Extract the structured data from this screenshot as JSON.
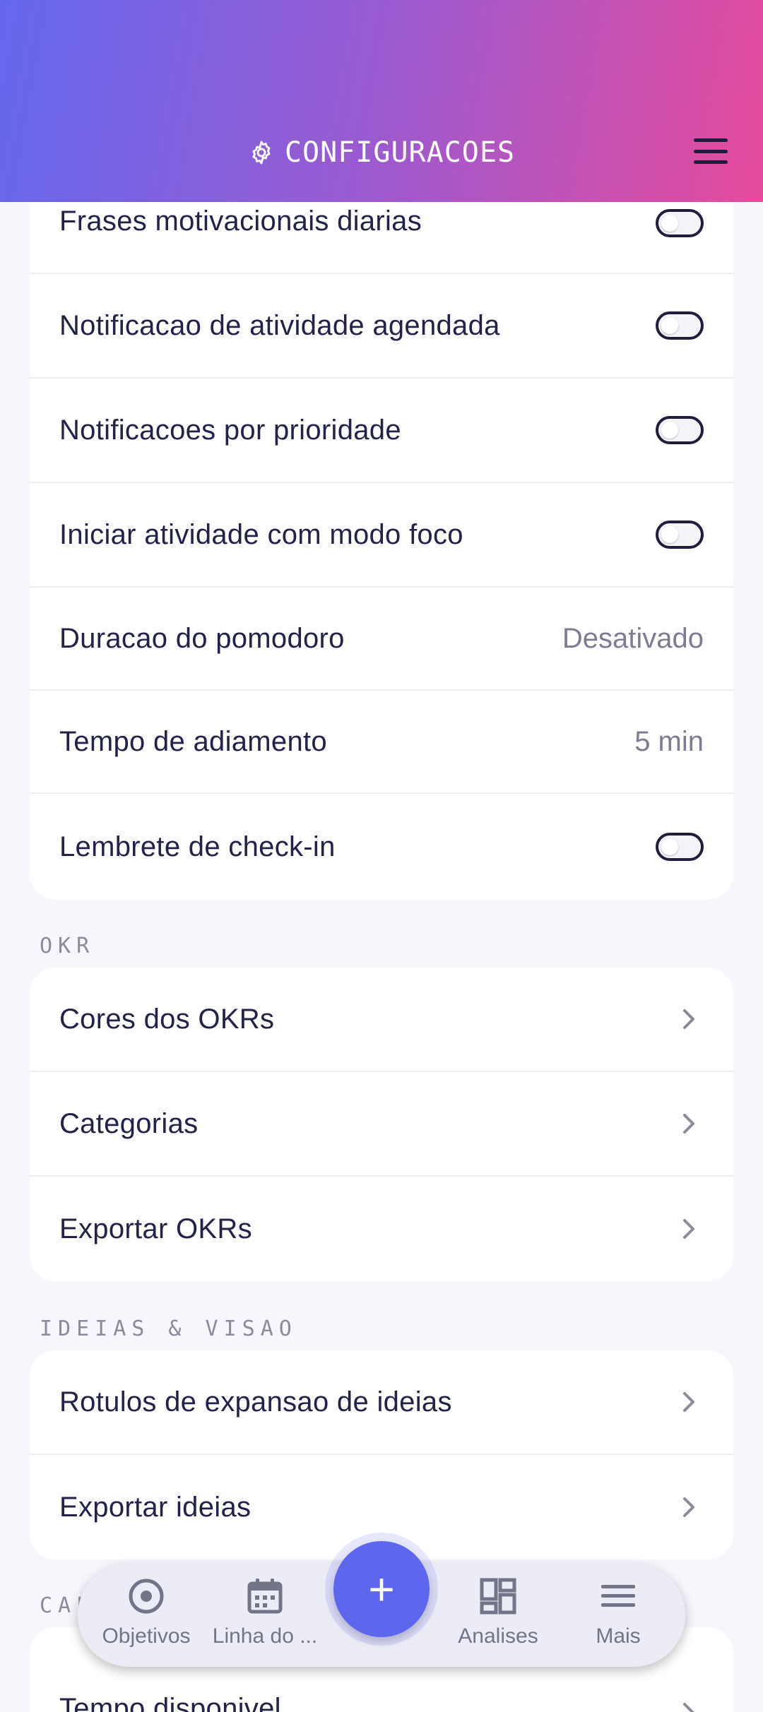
{
  "header": {
    "title": "CONFIGURACOES",
    "title_icon": "gear-icon",
    "menu_icon": "hamburger-menu-icon",
    "gradient": [
      "#6468ee",
      "#e64b9c"
    ]
  },
  "notifications": {
    "items": [
      {
        "label": "Frases motivacionais diarias",
        "type": "toggle",
        "on": false
      },
      {
        "label": "Notificacao de atividade agendada",
        "type": "toggle",
        "on": false
      },
      {
        "label": "Notificacoes por prioridade",
        "type": "toggle",
        "on": false
      },
      {
        "label": "Iniciar atividade com modo foco",
        "type": "toggle",
        "on": false
      },
      {
        "label": "Duracao do pomodoro",
        "type": "value",
        "value": "Desativado"
      },
      {
        "label": "Tempo de adiamento",
        "type": "value",
        "value": "5 min"
      },
      {
        "label": "Lembrete de check-in",
        "type": "toggle",
        "on": false
      }
    ]
  },
  "okr": {
    "title": "OKR",
    "items": [
      {
        "label": "Cores dos OKRs"
      },
      {
        "label": "Categorias"
      },
      {
        "label": "Exportar OKRs"
      }
    ]
  },
  "ideias": {
    "title": "IDEIAS & VISAO",
    "items": [
      {
        "label": "Rotulos de expansao de ideias"
      },
      {
        "label": "Exportar ideias"
      }
    ]
  },
  "calendar_section": {
    "title_partial": "CAL",
    "items": [
      {
        "label": "Tempo disponivel"
      }
    ]
  },
  "bottom_nav": {
    "items": [
      {
        "label": "Objetivos",
        "icon": "target-icon"
      },
      {
        "label": "Linha do ...",
        "icon": "calendar-icon"
      },
      {
        "label": "Analises",
        "icon": "dashboard-icon"
      },
      {
        "label": "Mais",
        "icon": "menu-icon"
      }
    ],
    "fab_label": "+",
    "accent": "#5f66ee"
  }
}
